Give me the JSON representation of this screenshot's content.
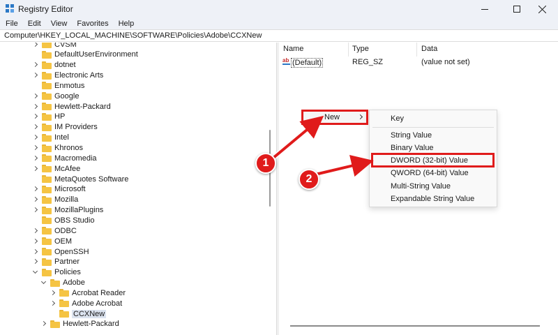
{
  "window": {
    "title": "Registry Editor",
    "icons": {
      "app": "registry-editor-icon",
      "minimize": "minimize-icon",
      "maximize": "maximize-icon",
      "close": "close-icon"
    }
  },
  "menu": [
    "File",
    "Edit",
    "View",
    "Favorites",
    "Help"
  ],
  "address": "Computer\\HKEY_LOCAL_MACHINE\\SOFTWARE\\Policies\\Adobe\\CCXNew",
  "tree": {
    "items": [
      {
        "label": "CVSM",
        "expander": "right"
      },
      {
        "label": "DefaultUserEnvironment",
        "expander": "none"
      },
      {
        "label": "dotnet",
        "expander": "right"
      },
      {
        "label": "Electronic Arts",
        "expander": "right"
      },
      {
        "label": "Enmotus",
        "expander": "none"
      },
      {
        "label": "Google",
        "expander": "right"
      },
      {
        "label": "Hewlett-Packard",
        "expander": "right"
      },
      {
        "label": "HP",
        "expander": "right"
      },
      {
        "label": "IM Providers",
        "expander": "right"
      },
      {
        "label": "Intel",
        "expander": "right"
      },
      {
        "label": "Khronos",
        "expander": "right"
      },
      {
        "label": "Macromedia",
        "expander": "right"
      },
      {
        "label": "McAfee",
        "expander": "right"
      },
      {
        "label": "MetaQuotes Software",
        "expander": "none"
      },
      {
        "label": "Microsoft",
        "expander": "right"
      },
      {
        "label": "Mozilla",
        "expander": "right"
      },
      {
        "label": "MozillaPlugins",
        "expander": "right"
      },
      {
        "label": "OBS Studio",
        "expander": "none"
      },
      {
        "label": "ODBC",
        "expander": "right"
      },
      {
        "label": "OEM",
        "expander": "right"
      },
      {
        "label": "OpenSSH",
        "expander": "right"
      },
      {
        "label": "Partner",
        "expander": "right"
      },
      {
        "label": "Policies",
        "expander": "down"
      },
      {
        "label": "Adobe",
        "expander": "down"
      },
      {
        "label": "Acrobat Reader",
        "expander": "right"
      },
      {
        "label": "Adobe Acrobat",
        "expander": "right"
      },
      {
        "label": "CCXNew",
        "expander": "none",
        "selected": true
      },
      {
        "label": "Hewlett-Packard",
        "expander": "right"
      }
    ],
    "folder_icon": "folder-icon"
  },
  "list": {
    "columns": [
      "Name",
      "Type",
      "Data"
    ],
    "rows": [
      {
        "icon": "string-value-icon",
        "icon_text": "ab",
        "name": "(Default)",
        "type": "REG_SZ",
        "data": "(value not set)"
      }
    ]
  },
  "context_menu": {
    "new_label": "New",
    "submenu": [
      "Key",
      "String Value",
      "Binary Value",
      "DWORD (32-bit) Value",
      "QWORD (64-bit) Value",
      "Multi-String Value",
      "Expandable String Value"
    ]
  },
  "annotations": {
    "color": "#e01b1b",
    "steps": [
      "1",
      "2"
    ]
  }
}
